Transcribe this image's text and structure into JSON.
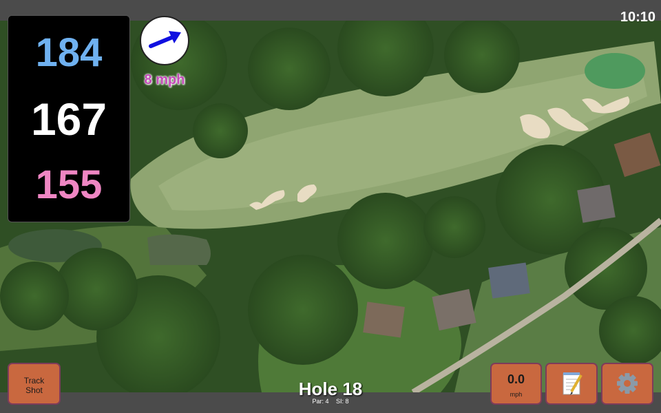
{
  "status": {
    "time": "10:10"
  },
  "yardages": {
    "back": "184",
    "middle": "167",
    "front": "155"
  },
  "wind": {
    "speed": "8 mph",
    "icon": "wind-direction-arrow-icon"
  },
  "hole": {
    "title": "Hole 18",
    "par": "Par: 4",
    "stroke_index": "SI: 8"
  },
  "buttons": {
    "track_line1": "Track",
    "track_line2": "Shot",
    "speed_value": "0.0",
    "speed_unit": "mph",
    "notes_icon": "notepad-icon",
    "settings_icon": "gear-icon"
  },
  "colors": {
    "back_yardage": "#6fb1f0",
    "middle_yardage": "#ffffff",
    "front_yardage": "#ef86c3",
    "wind_speed": "#c44bb8",
    "button_fill": "#c9683f"
  }
}
